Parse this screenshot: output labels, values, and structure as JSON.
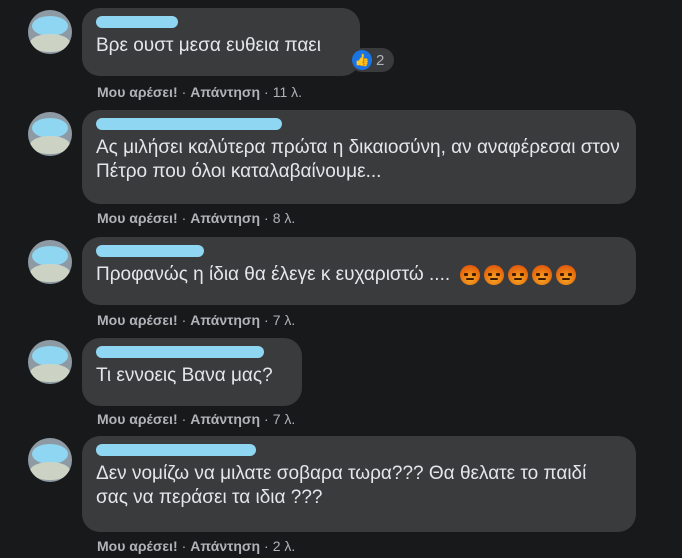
{
  "comments": [
    {
      "author": "",
      "text": "Βρε ουστ μεσα ευθεια παει",
      "reactions": {
        "type": "like",
        "count": "2"
      },
      "actions": {
        "like": "Μου αρέσει!",
        "reply": "Απάντηση",
        "time": "11 λ."
      }
    },
    {
      "author": "",
      "text": "Ας μιλήσει καλύτερα πρώτα η δικαιοσύνη, αν αναφέρεσαι στον Πέτρο που όλοι καταλαβαίνουμε...",
      "actions": {
        "like": "Μου αρέσει!",
        "reply": "Απάντηση",
        "time": "8 λ."
      }
    },
    {
      "author": "",
      "text": "Προφανώς η ίδια θα έλεγε κ ευχαριστώ ....",
      "emojis": [
        "angry-emoji",
        "angry-emoji",
        "angry-emoji",
        "angry-emoji",
        "angry-emoji"
      ],
      "actions": {
        "like": "Μου αρέσει!",
        "reply": "Απάντηση",
        "time": "7 λ."
      }
    },
    {
      "author": "",
      "text": "Τι εννοεις Βανα μας?",
      "actions": {
        "like": "Μου αρέσει!",
        "reply": "Απάντηση",
        "time": "7 λ."
      }
    },
    {
      "author": "",
      "text": "Δεν νομίζω να μιλατε σοβαρα τωρα??? Θα θελατε το παιδί σας να περάσει τα ιδια ???",
      "actions": {
        "like": "Μου αρέσει!",
        "reply": "Απάντηση",
        "time": "2 λ."
      }
    }
  ],
  "separator": "·",
  "colors": {
    "background": "#18191a",
    "bubble": "#3a3b3c",
    "text": "#e4e6eb",
    "muted": "#b0b3b8",
    "like_blue": "#1b74e4",
    "redaction": "#8fd6f2"
  }
}
